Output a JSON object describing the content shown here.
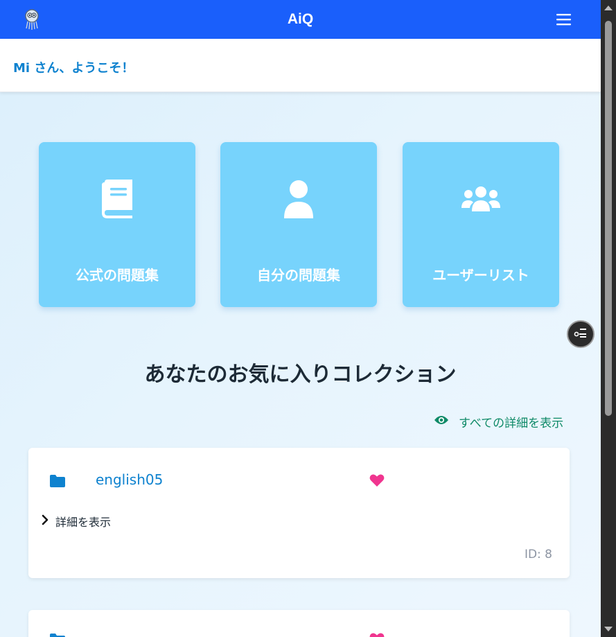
{
  "header": {
    "title": "AiQ",
    "logo_icon": "owl-logo-icon",
    "menu_icon": "hamburger-menu-icon",
    "bg_color": "#1a5ffb"
  },
  "welcome": {
    "text": "Mi さん、ようこそ！",
    "color": "#0e82cf"
  },
  "tiles": [
    {
      "label": "公式の問題集",
      "icon": "book-icon"
    },
    {
      "label": "自分の問題集",
      "icon": "user-icon"
    },
    {
      "label": "ユーザーリスト",
      "icon": "users-icon"
    }
  ],
  "tile_color": "#77d3fc",
  "floating_button": {
    "icon": "toggle-list-icon"
  },
  "favorites": {
    "title": "あなたのお気に入りコレクション",
    "show_all_label": "すべての詳細を表示",
    "show_all_icon": "eye-icon",
    "show_all_color": "#0f8a68"
  },
  "cards": [
    {
      "title": "english05",
      "details_label": "詳細を表示",
      "id_text": "ID: 8",
      "folder_icon": "folder-icon",
      "heart_icon": "heart-icon"
    },
    {
      "folder_icon": "folder-icon",
      "heart_icon": "heart-icon"
    }
  ],
  "heart_color": "#f0358f"
}
